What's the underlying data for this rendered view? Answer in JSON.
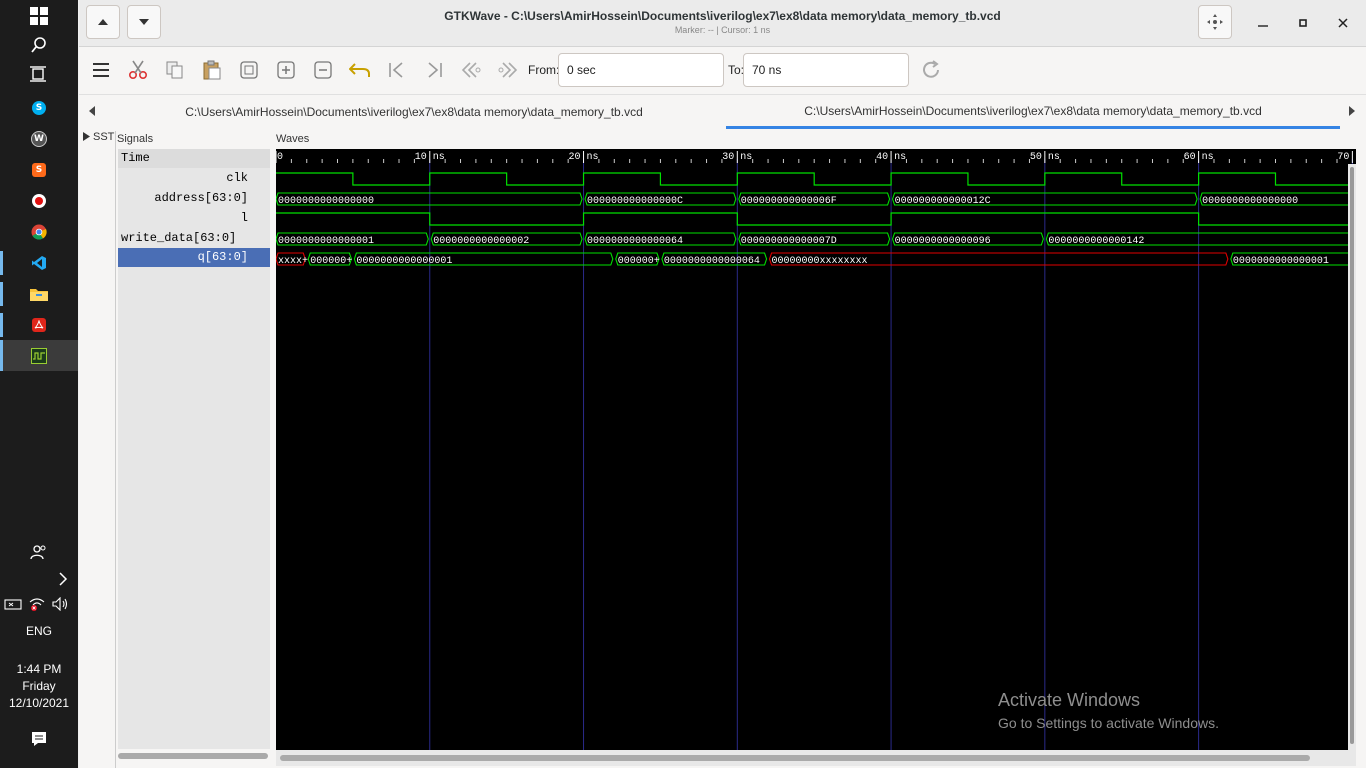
{
  "taskbar": {
    "language": "ENG",
    "time": "1:44 PM",
    "day": "Friday",
    "date": "12/10/2021"
  },
  "window": {
    "title": "GTKWave - C:\\Users\\AmirHossein\\Documents\\iverilog\\ex7\\ex8\\data memory\\data_memory_tb.vcd",
    "subtitle": "Marker: --  |  Cursor: 1 ns"
  },
  "toolbar": {
    "from_label": "From:",
    "from_value": "0 sec",
    "to_label": "To:",
    "to_value": "70 ns"
  },
  "tabs": [
    {
      "label": "C:\\Users\\AmirHossein\\Documents\\iverilog\\ex7\\ex8\\data memory\\data_memory_tb.vcd",
      "active": false
    },
    {
      "label": "C:\\Users\\AmirHossein\\Documents\\iverilog\\ex7\\ex8\\data memory\\data_memory_tb.vcd",
      "active": true
    }
  ],
  "panes": {
    "sst_label": "SST",
    "signals_title": "Signals",
    "waves_title": "Waves"
  },
  "signals": {
    "time": "Time",
    "clk": "clk",
    "address": "address[63:0]",
    "l": "l",
    "write_data": "write_data[63:0]",
    "q": "q[63:0]"
  },
  "timescale": {
    "ticks": [
      "0",
      "10 ns",
      "20 ns",
      "30 ns",
      "40 ns",
      "50 ns",
      "60 ns",
      "70"
    ],
    "range_ns": [
      0,
      70
    ]
  },
  "waves": {
    "clk_edges_ns": [
      0,
      5,
      10,
      15,
      20,
      25,
      30,
      35,
      40,
      45,
      50,
      55,
      60,
      65
    ],
    "clk_initial": 1,
    "l_edges_ns": [
      10,
      20,
      30,
      40,
      60
    ],
    "l_initial": 1,
    "address": [
      {
        "start": 0,
        "end": 20,
        "value": "0000000000000000"
      },
      {
        "start": 20,
        "end": 30,
        "value": "000000000000000C"
      },
      {
        "start": 30,
        "end": 40,
        "value": "000000000000006F"
      },
      {
        "start": 40,
        "end": 60,
        "value": "000000000000012C"
      },
      {
        "start": 60,
        "end": 70,
        "value": "0000000000000000"
      }
    ],
    "write_data": [
      {
        "start": 0,
        "end": 10,
        "value": "0000000000000001"
      },
      {
        "start": 10,
        "end": 20,
        "value": "0000000000000002"
      },
      {
        "start": 20,
        "end": 30,
        "value": "0000000000000064"
      },
      {
        "start": 30,
        "end": 40,
        "value": "000000000000007D"
      },
      {
        "start": 40,
        "end": 50,
        "value": "0000000000000096"
      },
      {
        "start": 50,
        "end": 70,
        "value": "0000000000000142"
      }
    ],
    "q": [
      {
        "start": 0,
        "end": 2,
        "value": "xxxx+",
        "unknown": true
      },
      {
        "start": 2,
        "end": 5,
        "value": "000000+",
        "unknown": false
      },
      {
        "start": 5,
        "end": 22,
        "value": "0000000000000001",
        "unknown": false
      },
      {
        "start": 22,
        "end": 25,
        "value": "000000+",
        "unknown": false
      },
      {
        "start": 25,
        "end": 32,
        "value": "0000000000000064",
        "unknown": false
      },
      {
        "start": 32,
        "end": 62,
        "value": "00000000xxxxxxxx",
        "unknown": true
      },
      {
        "start": 62,
        "end": 70,
        "value": "0000000000000001",
        "unknown": false
      }
    ]
  },
  "watermark": {
    "line1": "Activate Windows",
    "line2": "Go to Settings to activate Windows."
  },
  "colors": {
    "wave_green": "#00e000",
    "unknown_red": "#e00000",
    "grid_blue": "#2a2a8a",
    "selection": "#4a6eb5",
    "tab_underline": "#3584e4"
  }
}
